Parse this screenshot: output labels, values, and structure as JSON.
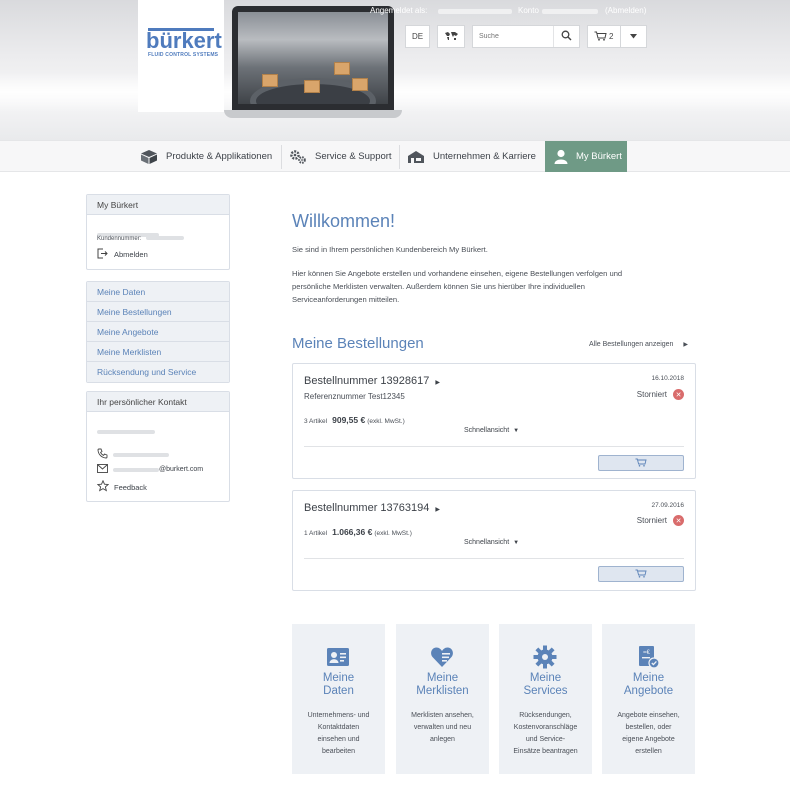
{
  "header": {
    "logo_text": "bürkert",
    "logo_sub": "FLUID CONTROL SYSTEMS",
    "logged_in_label": "Angemeldet als:",
    "account_label": "Konto",
    "logout_link": "(Abmelden)",
    "language": "DE",
    "search_placeholder": "Suche",
    "cart_count": "2"
  },
  "nav": {
    "items": [
      {
        "label": "Produkte & Applikationen",
        "icon": "products-icon"
      },
      {
        "label": "Service & Support",
        "icon": "service-gears-icon"
      },
      {
        "label": "Unternehmen & Karriere",
        "icon": "company-building-icon"
      },
      {
        "label": "My Bürkert",
        "icon": "user-icon"
      }
    ],
    "active_color": "#6f9a86"
  },
  "sidebar": {
    "account_panel": {
      "title": "My Bürkert",
      "customer_number_label": "Kundennummer:",
      "logout_label": "Abmelden"
    },
    "menu": [
      {
        "label": "Meine Daten"
      },
      {
        "label": "Meine Bestellungen"
      },
      {
        "label": "Meine Angebote"
      },
      {
        "label": "Meine Merklisten"
      },
      {
        "label": "Rücksendung und Service"
      }
    ],
    "contact_panel": {
      "title": "Ihr persönlicher Kontakt",
      "email_suffix": "@burkert.com",
      "feedback_label": "Feedback"
    }
  },
  "main": {
    "welcome_title": "Willkommen!",
    "intro_1": "Sie sind in Ihrem persönlichen Kundenbereich My Bürkert.",
    "intro_2": "Hier können Sie Angebote erstellen und vorhandene einsehen, eigene Bestellungen verfolgen und",
    "intro_3": "persönliche Merklisten verwalten. Außerdem können Sie uns hierüber Ihre individuellen",
    "intro_4": "Serviceanforderungen mitteilen.",
    "orders_title": "Meine Bestellungen",
    "all_orders_link": "Alle Bestellungen anzeigen",
    "orders": [
      {
        "title": "Bestellnummer 13928617",
        "reference": "Referenznummer Test12345",
        "date": "16.10.2018",
        "status": "Storniert",
        "articles": "3 Artikel",
        "amount": "909,55 €",
        "tax_note": "(exkl. MwSt.)",
        "quickview": "Schnellansicht"
      },
      {
        "title": "Bestellnummer 13763194",
        "reference": "",
        "date": "27.09.2016",
        "status": "Storniert",
        "articles": "1 Artikel",
        "amount": "1.066,36 €",
        "tax_note": "(exkl. MwSt.)",
        "quickview": "Schnellansicht"
      }
    ],
    "tiles": [
      {
        "title": "Meine\nDaten",
        "desc": "Unternehmens- und\nKontaktdaten\neinsehen und\nbearbeiten",
        "icon": "contact-card-icon"
      },
      {
        "title": "Meine\nMerklisten",
        "desc": "Merklisten ansehen,\nverwalten und neu\nanlegen",
        "icon": "heart-list-icon"
      },
      {
        "title": "Meine\nServices",
        "desc": "Rücksendungen,\nKostenvoranschläge\nund Service-\nEinsätze beantragen",
        "icon": "gear-icon"
      },
      {
        "title": "Meine\nAngebote",
        "desc": "Angebote einsehen,\nbestellen, oder\neigene Angebote\nerstellen",
        "icon": "quote-document-icon"
      }
    ]
  },
  "colors": {
    "brand_blue": "#5b83b8",
    "nav_active": "#6f9a86",
    "cancel_red": "#d96c6c",
    "tile_bg": "#eef1f5"
  }
}
